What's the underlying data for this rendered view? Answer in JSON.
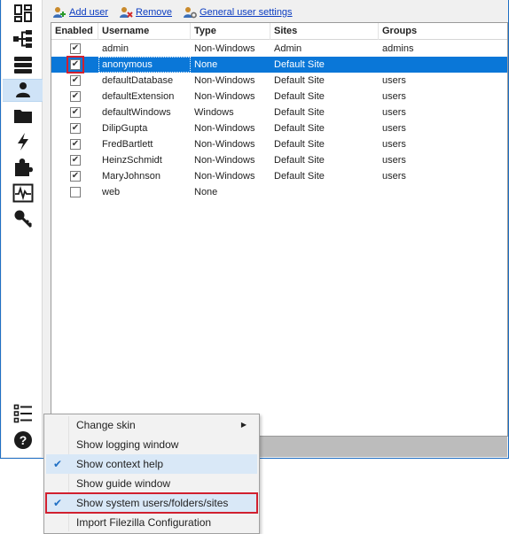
{
  "toolbar": {
    "add_user": "Add user",
    "remove": "Remove",
    "general_settings": "General user settings"
  },
  "sidebar": {
    "items": [
      {
        "name": "dashboard"
      },
      {
        "name": "groups-hierarchy"
      },
      {
        "name": "servers"
      },
      {
        "name": "users",
        "active": true
      },
      {
        "name": "folders"
      },
      {
        "name": "events"
      },
      {
        "name": "plugins"
      },
      {
        "name": "monitoring"
      },
      {
        "name": "keys"
      },
      {
        "name": "settings-menu"
      },
      {
        "name": "help"
      }
    ]
  },
  "grid": {
    "columns": [
      "Enabled",
      "Username",
      "Type",
      "Sites",
      "Groups"
    ],
    "rows": [
      {
        "enabled": true,
        "username": "admin",
        "type": "Non-Windows",
        "sites": "Admin",
        "groups": "admins"
      },
      {
        "enabled": true,
        "username": "anonymous",
        "type": "None",
        "sites": "Default Site",
        "groups": ""
      },
      {
        "enabled": true,
        "username": "defaultDatabase",
        "type": "Non-Windows",
        "sites": "Default Site",
        "groups": "users"
      },
      {
        "enabled": true,
        "username": "defaultExtension",
        "type": "Non-Windows",
        "sites": "Default Site",
        "groups": "users"
      },
      {
        "enabled": true,
        "username": "defaultWindows",
        "type": "Windows",
        "sites": "Default Site",
        "groups": "users"
      },
      {
        "enabled": true,
        "username": "DilipGupta",
        "type": "Non-Windows",
        "sites": "Default Site",
        "groups": "users"
      },
      {
        "enabled": true,
        "username": "FredBartlett",
        "type": "Non-Windows",
        "sites": "Default Site",
        "groups": "users"
      },
      {
        "enabled": true,
        "username": "HeinzSchmidt",
        "type": "Non-Windows",
        "sites": "Default Site",
        "groups": "users"
      },
      {
        "enabled": true,
        "username": "MaryJohnson",
        "type": "Non-Windows",
        "sites": "Default Site",
        "groups": "users"
      },
      {
        "enabled": false,
        "username": "web",
        "type": "None",
        "sites": "",
        "groups": ""
      }
    ]
  },
  "context_menu": {
    "items": [
      {
        "label": "Change skin",
        "submenu": true,
        "checked": false
      },
      {
        "label": "Show logging window",
        "checked": false
      },
      {
        "label": "Show context help",
        "checked": true
      },
      {
        "label": "Show guide window",
        "checked": false
      },
      {
        "label": "Show system users/folders/sites",
        "checked": true,
        "highlighted": true
      },
      {
        "label": "Import Filezilla Configuration",
        "checked": false
      }
    ]
  },
  "colors": {
    "selection": "#0a77d8",
    "highlight_outline": "#d1202f",
    "link": "#0b3cc1",
    "icon": "#1b1b1b"
  }
}
